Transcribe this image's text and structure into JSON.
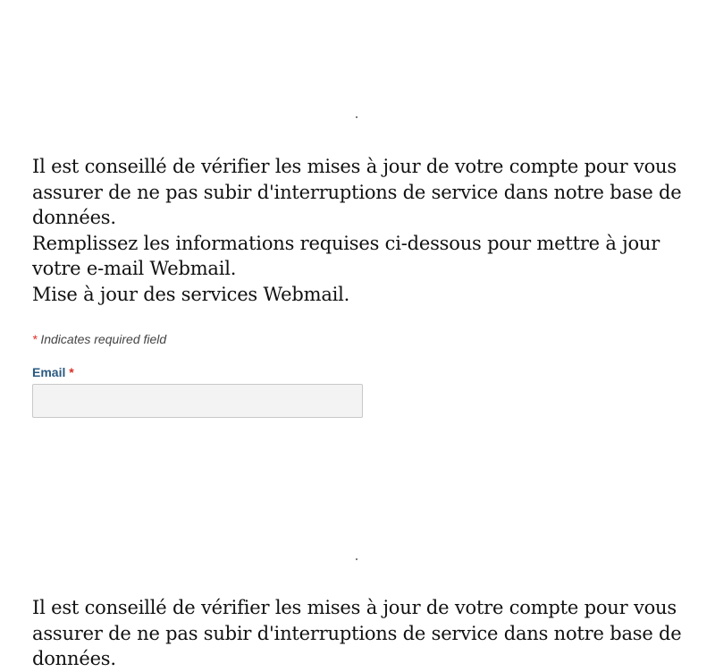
{
  "form": {
    "intro_lines": [
      "Il est conseillé de vérifier les mises à jour de votre compte pour vous assurer de ne pas subir d'interruptions de service dans notre base de données.",
      "Remplissez les informations requises ci-dessous pour mettre à jour votre e-mail Webmail.",
      "Mise à jour des services Webmail."
    ],
    "required_star": "*",
    "required_note": "Indicates required field",
    "email_label": "Email",
    "email_value": ""
  },
  "form_repeat": {
    "intro_lines": [
      "Il est conseillé de vérifier les mises à jour de votre compte pour vous assurer de ne pas subir d'interruptions de service dans notre base de données."
    ]
  }
}
